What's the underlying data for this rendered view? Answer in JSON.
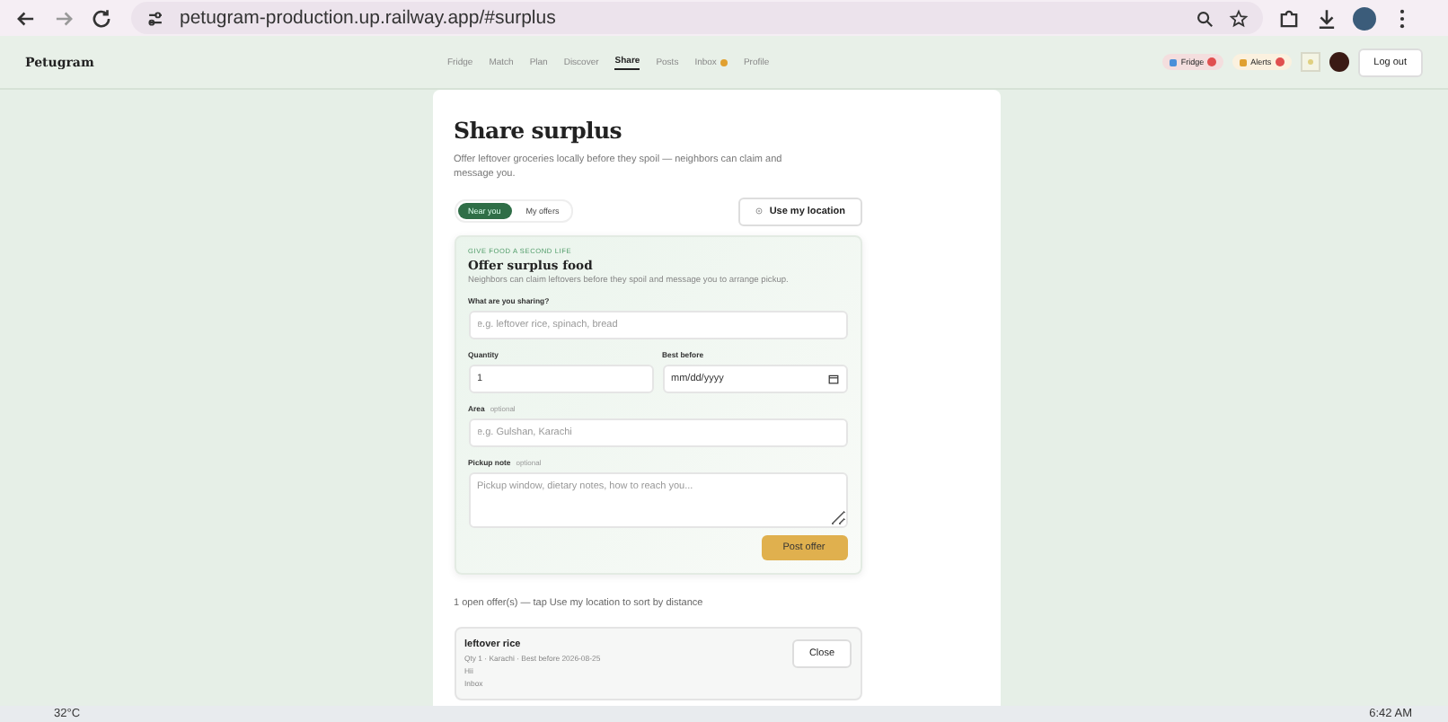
{
  "browser": {
    "url": "petugram-production.up.railway.app/#surplus"
  },
  "nav": {
    "brand": "Petugram",
    "links": [
      {
        "label": "Fridge",
        "selected": false,
        "dot": false
      },
      {
        "label": "Match",
        "selected": false,
        "dot": false
      },
      {
        "label": "Plan",
        "selected": false,
        "dot": false
      },
      {
        "label": "Discover",
        "selected": false,
        "dot": false
      },
      {
        "label": "Share",
        "selected": true,
        "dot": false
      },
      {
        "label": "Posts",
        "selected": false,
        "dot": false
      },
      {
        "label": "Inbox",
        "selected": false,
        "dot": true
      },
      {
        "label": "Profile",
        "selected": false,
        "dot": false
      }
    ],
    "chips": [
      {
        "label": "Fridge",
        "color": "#4a90d9"
      },
      {
        "label": "Alerts",
        "color": "#e0a030"
      }
    ],
    "logout": "Log out"
  },
  "page": {
    "title": "Share surplus",
    "description": "Offer leftover groceries locally before they spoil — neighbors can claim and message you.",
    "tabs": [
      {
        "label": "Near you",
        "selected": true
      },
      {
        "label": "My offers",
        "selected": false
      }
    ],
    "location_button": "Use my location",
    "form": {
      "eyebrow": "GIVE FOOD A SECOND LIFE",
      "title": "Offer surplus food",
      "description": "Neighbors can claim leftovers before they spoil and message you to arrange pickup.",
      "what": {
        "label": "What are you sharing?",
        "placeholder": "e.g. leftover rice, spinach, bread"
      },
      "quantity": {
        "label": "Quantity",
        "value": "1"
      },
      "best_before": {
        "label": "Best before",
        "value": "mm/dd/yyyy"
      },
      "area": {
        "label": "Area",
        "hint": "optional",
        "placeholder": "e.g. Gulshan, Karachi"
      },
      "note": {
        "label": "Pickup note",
        "hint": "optional",
        "placeholder": "Pickup window, dietary notes, how to reach you..."
      },
      "submit": "Post offer"
    },
    "count_text": "1 open offer(s) — tap Use my location to sort by distance",
    "offers": [
      {
        "title": "leftover rice",
        "meta": "Qty 1 · Karachi · Best before 2026-08-25",
        "note": "Hii",
        "link": "Inbox",
        "action": "Close"
      }
    ]
  },
  "taskbar": {
    "weather": "32°C",
    "time": "6:42 AM"
  }
}
